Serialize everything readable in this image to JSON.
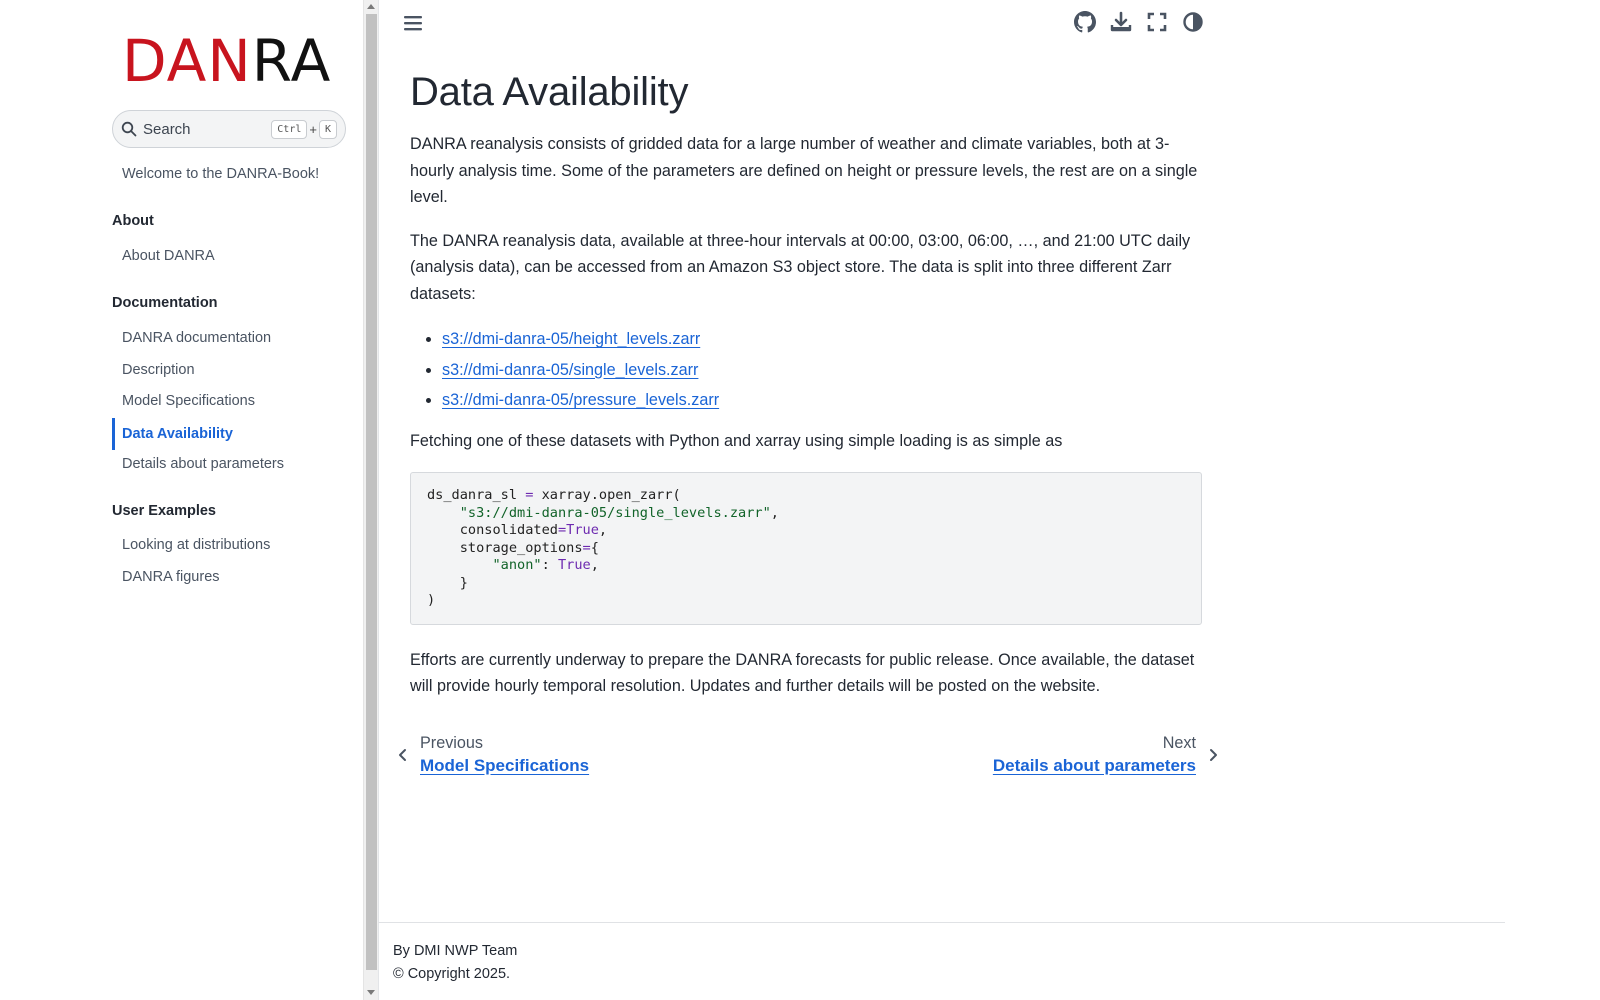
{
  "logo": {
    "part1": "DAN",
    "part2": "RA"
  },
  "search": {
    "placeholder": "Search",
    "key1": "Ctrl",
    "plus": "+",
    "key2": "K"
  },
  "sidebar": {
    "welcome": "Welcome to the DANRA-Book!",
    "sections": [
      {
        "caption": "About",
        "items": [
          "About DANRA"
        ]
      },
      {
        "caption": "Documentation",
        "items": [
          "DANRA documentation",
          "Description",
          "Model Specifications",
          "Data Availability",
          "Details about parameters"
        ]
      },
      {
        "caption": "User Examples",
        "items": [
          "Looking at distributions",
          "DANRA figures"
        ]
      }
    ],
    "active_item": "Data Availability"
  },
  "toolbar": {
    "icons": [
      "github-icon",
      "download-icon",
      "fullscreen-icon",
      "theme-toggle-icon"
    ]
  },
  "article": {
    "title": "Data Availability",
    "para1": "DANRA reanalysis consists of gridded data for a large number of weather and climate variables, both at 3-hourly analysis time. Some of the parameters are defined on height or pressure levels, the rest are on a single level.",
    "para2": "The DANRA reanalysis data, available at three-hour intervals at 00:00, 03:00, 06:00, …, and 21:00 UTC daily (analysis data), can be accessed from an Amazon S3 object store. The data is split into three different Zarr datasets:",
    "links": [
      "s3://dmi-danra-05/height_levels.zarr",
      "s3://dmi-danra-05/single_levels.zarr",
      "s3://dmi-danra-05/pressure_levels.zarr"
    ],
    "para3": "Fetching one of these datasets with Python and xarray using simple loading is as simple as",
    "code": {
      "l1a": "ds_danra_sl ",
      "l1op": "=",
      "l1b": " xarray.open_zarr(",
      "l2str": "\"s3://dmi-danra-05/single_levels.zarr\"",
      "l2b": ",",
      "l3a": "consolidated",
      "l3op": "=",
      "l3kw": "True",
      "l3b": ",",
      "l4a": "storage_options",
      "l4op": "=",
      "l4b": "{",
      "l5str": "\"anon\"",
      "l5a": ": ",
      "l5kw": "True",
      "l5b": ",",
      "l6": "}",
      "l7": ")"
    },
    "para4": "Efforts are currently underway to prepare the DANRA forecasts for public release. Once available, the dataset will provide hourly temporal resolution. Updates and further details will be posted on the website."
  },
  "prevnext": {
    "prev_label": "Previous",
    "prev_title": "Model Specifications",
    "next_label": "Next",
    "next_title": "Details about parameters"
  },
  "footer": {
    "author": "By DMI NWP Team",
    "copyright": "© Copyright 2025."
  },
  "colors": {
    "accent": "#1a64d6",
    "logo_red": "#c8141e",
    "code_bg": "#f3f4f5"
  }
}
